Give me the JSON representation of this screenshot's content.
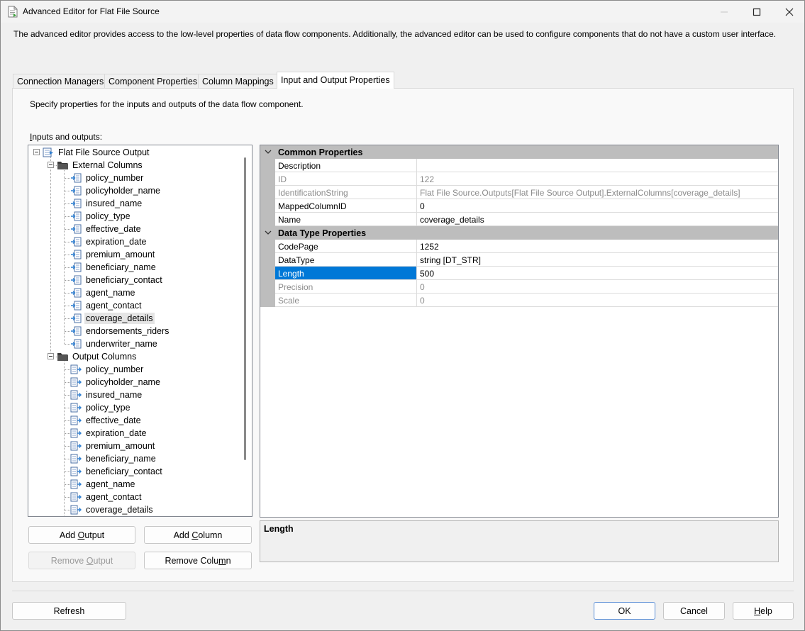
{
  "window": {
    "title": "Advanced Editor for Flat File Source",
    "description": "The advanced editor provides access to the low-level properties of data flow components. Additionally, the advanced editor can be used to configure components that do not have a custom user interface."
  },
  "tabs": [
    {
      "label": "Connection Managers"
    },
    {
      "label": "Component Properties"
    },
    {
      "label": "Column Mappings"
    },
    {
      "label": "Input and Output Properties"
    }
  ],
  "panel": {
    "instructions": "Specify properties for the inputs and outputs of the data flow component.",
    "io_label": "Inputs and outputs:"
  },
  "tree": {
    "root": "Flat File Source Output",
    "external_folder": "External Columns",
    "external_columns": [
      "policy_number",
      "policyholder_name",
      "insured_name",
      "policy_type",
      "effective_date",
      "expiration_date",
      "premium_amount",
      "beneficiary_name",
      "beneficiary_contact",
      "agent_name",
      "agent_contact",
      "coverage_details",
      "endorsements_riders",
      "underwriter_name"
    ],
    "output_folder": "Output Columns",
    "output_columns": [
      "policy_number",
      "policyholder_name",
      "insured_name",
      "policy_type",
      "effective_date",
      "expiration_date",
      "premium_amount",
      "beneficiary_name",
      "beneficiary_contact",
      "agent_name",
      "agent_contact",
      "coverage_details"
    ]
  },
  "buttons": {
    "add_output": "Add Output",
    "add_column": "Add Column",
    "remove_output": "Remove Output",
    "remove_column": "Remove Column",
    "refresh": "Refresh",
    "ok": "OK",
    "cancel": "Cancel",
    "help": "Help"
  },
  "properties": {
    "common_header": "Common Properties",
    "common": [
      {
        "name": "Description",
        "value": "",
        "readonly": false
      },
      {
        "name": "ID",
        "value": "122",
        "readonly": true
      },
      {
        "name": "IdentificationString",
        "value": "Flat File Source.Outputs[Flat File Source Output].ExternalColumns[coverage_details]",
        "readonly": true
      },
      {
        "name": "MappedColumnID",
        "value": "0",
        "readonly": false
      },
      {
        "name": "Name",
        "value": "coverage_details",
        "readonly": false
      }
    ],
    "datatype_header": "Data Type Properties",
    "datatype": [
      {
        "name": "CodePage",
        "value": "1252",
        "readonly": false
      },
      {
        "name": "DataType",
        "value": "string [DT_STR]",
        "readonly": false
      },
      {
        "name": "Length",
        "value": "500",
        "readonly": false
      },
      {
        "name": "Precision",
        "value": "0",
        "readonly": true
      },
      {
        "name": "Scale",
        "value": "0",
        "readonly": true
      }
    ]
  },
  "help_pane": {
    "title": "Length"
  },
  "colors": {
    "selection": "#0078d7",
    "category_bg": "#bdbdbd"
  }
}
